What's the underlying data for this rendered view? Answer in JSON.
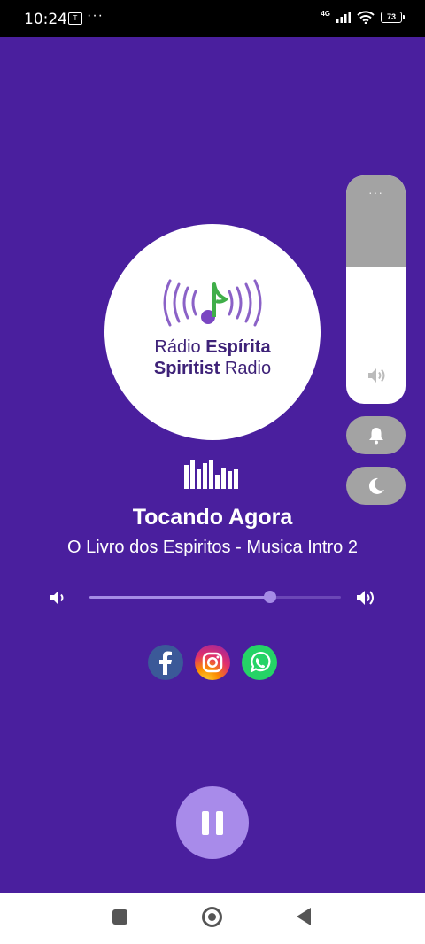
{
  "status_bar": {
    "time": "10:24",
    "notif_icon_label": "T",
    "more_dots": "···",
    "network": "4G",
    "battery": "73"
  },
  "logo": {
    "line1_regular": "Rádio ",
    "line1_bold": "Espírita",
    "line2_bold": "Spiritist",
    "line2_regular": " Radio",
    "ring_color": "#8b62c7",
    "note_color": "#3fae49"
  },
  "now_playing": {
    "title": "Tocando Agora",
    "track": "O Livro dos Espiritos - Musica Intro 2"
  },
  "volume": {
    "level": 0.72,
    "low_icon": "volume-low-icon",
    "high_icon": "volume-high-icon"
  },
  "social": [
    "facebook-icon",
    "instagram-icon",
    "whatsapp-icon"
  ],
  "system_volume_panel": {
    "dots": "···",
    "level": 0.6
  },
  "colors": {
    "background": "#4a1f9e",
    "accent": "#a88bea",
    "panel_gray": "#a3a3a3"
  }
}
